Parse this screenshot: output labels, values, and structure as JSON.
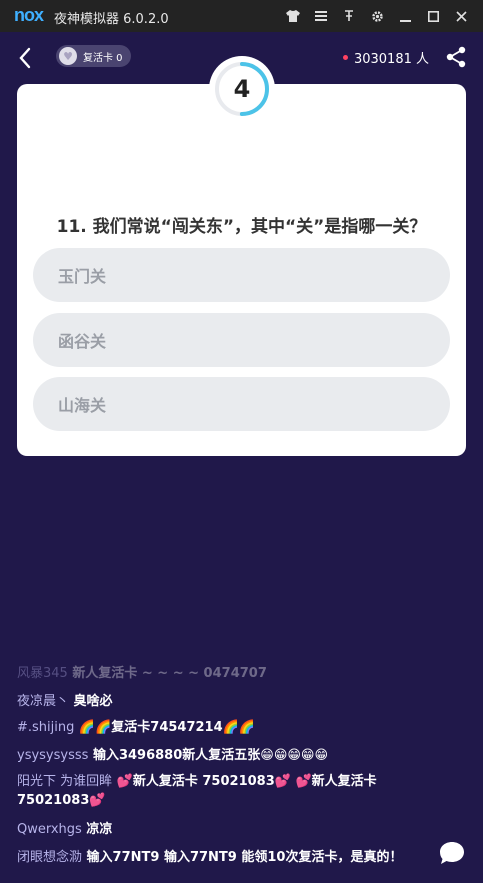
{
  "window": {
    "logo": "nox",
    "title": "夜神模拟器 6.0.2.0",
    "icons": [
      "shirt-icon",
      "menu-icon",
      "pin-icon",
      "settings-icon",
      "minimize-icon",
      "maximize-icon",
      "close-icon"
    ]
  },
  "header": {
    "revive_label": "复活卡 0",
    "viewer_count": "3030181 人"
  },
  "quiz": {
    "countdown": "4",
    "countdown_progress": 0.5,
    "question": "11. 我们常说“闯关东”，其中“关”是指哪一关？",
    "options": [
      "玉门关",
      "函谷关",
      "山海关"
    ]
  },
  "comments": [
    {
      "user": "风暴345",
      "text": "新人复活卡 ~ ~ ~ ~ 0474707"
    },
    {
      "user": "夜凉晨丶",
      "text": "臭啥必"
    },
    {
      "user": "#.shijing",
      "text": "🌈🌈复活卡74547214🌈🌈"
    },
    {
      "user": "ysysysysss",
      "text": "输入3496880新人复活五张😁😁😁😁😁"
    },
    {
      "user": "阳光下 为谁回眸",
      "text": "💕新人复活卡  75021083💕 💕新人复活卡 75021083💕"
    },
    {
      "user": "Qwerxhgs",
      "text": "凉凉"
    },
    {
      "user": "闭眼想念泐",
      "text": "输入77NT9  输入77NT9  能领10次复活卡，是真的！"
    }
  ],
  "colors": {
    "background": "#20184a",
    "card": "#ffffff",
    "timer_ring": "#4cc3e8",
    "username": "#b7b4ea",
    "live_dot": "#ff4262"
  }
}
